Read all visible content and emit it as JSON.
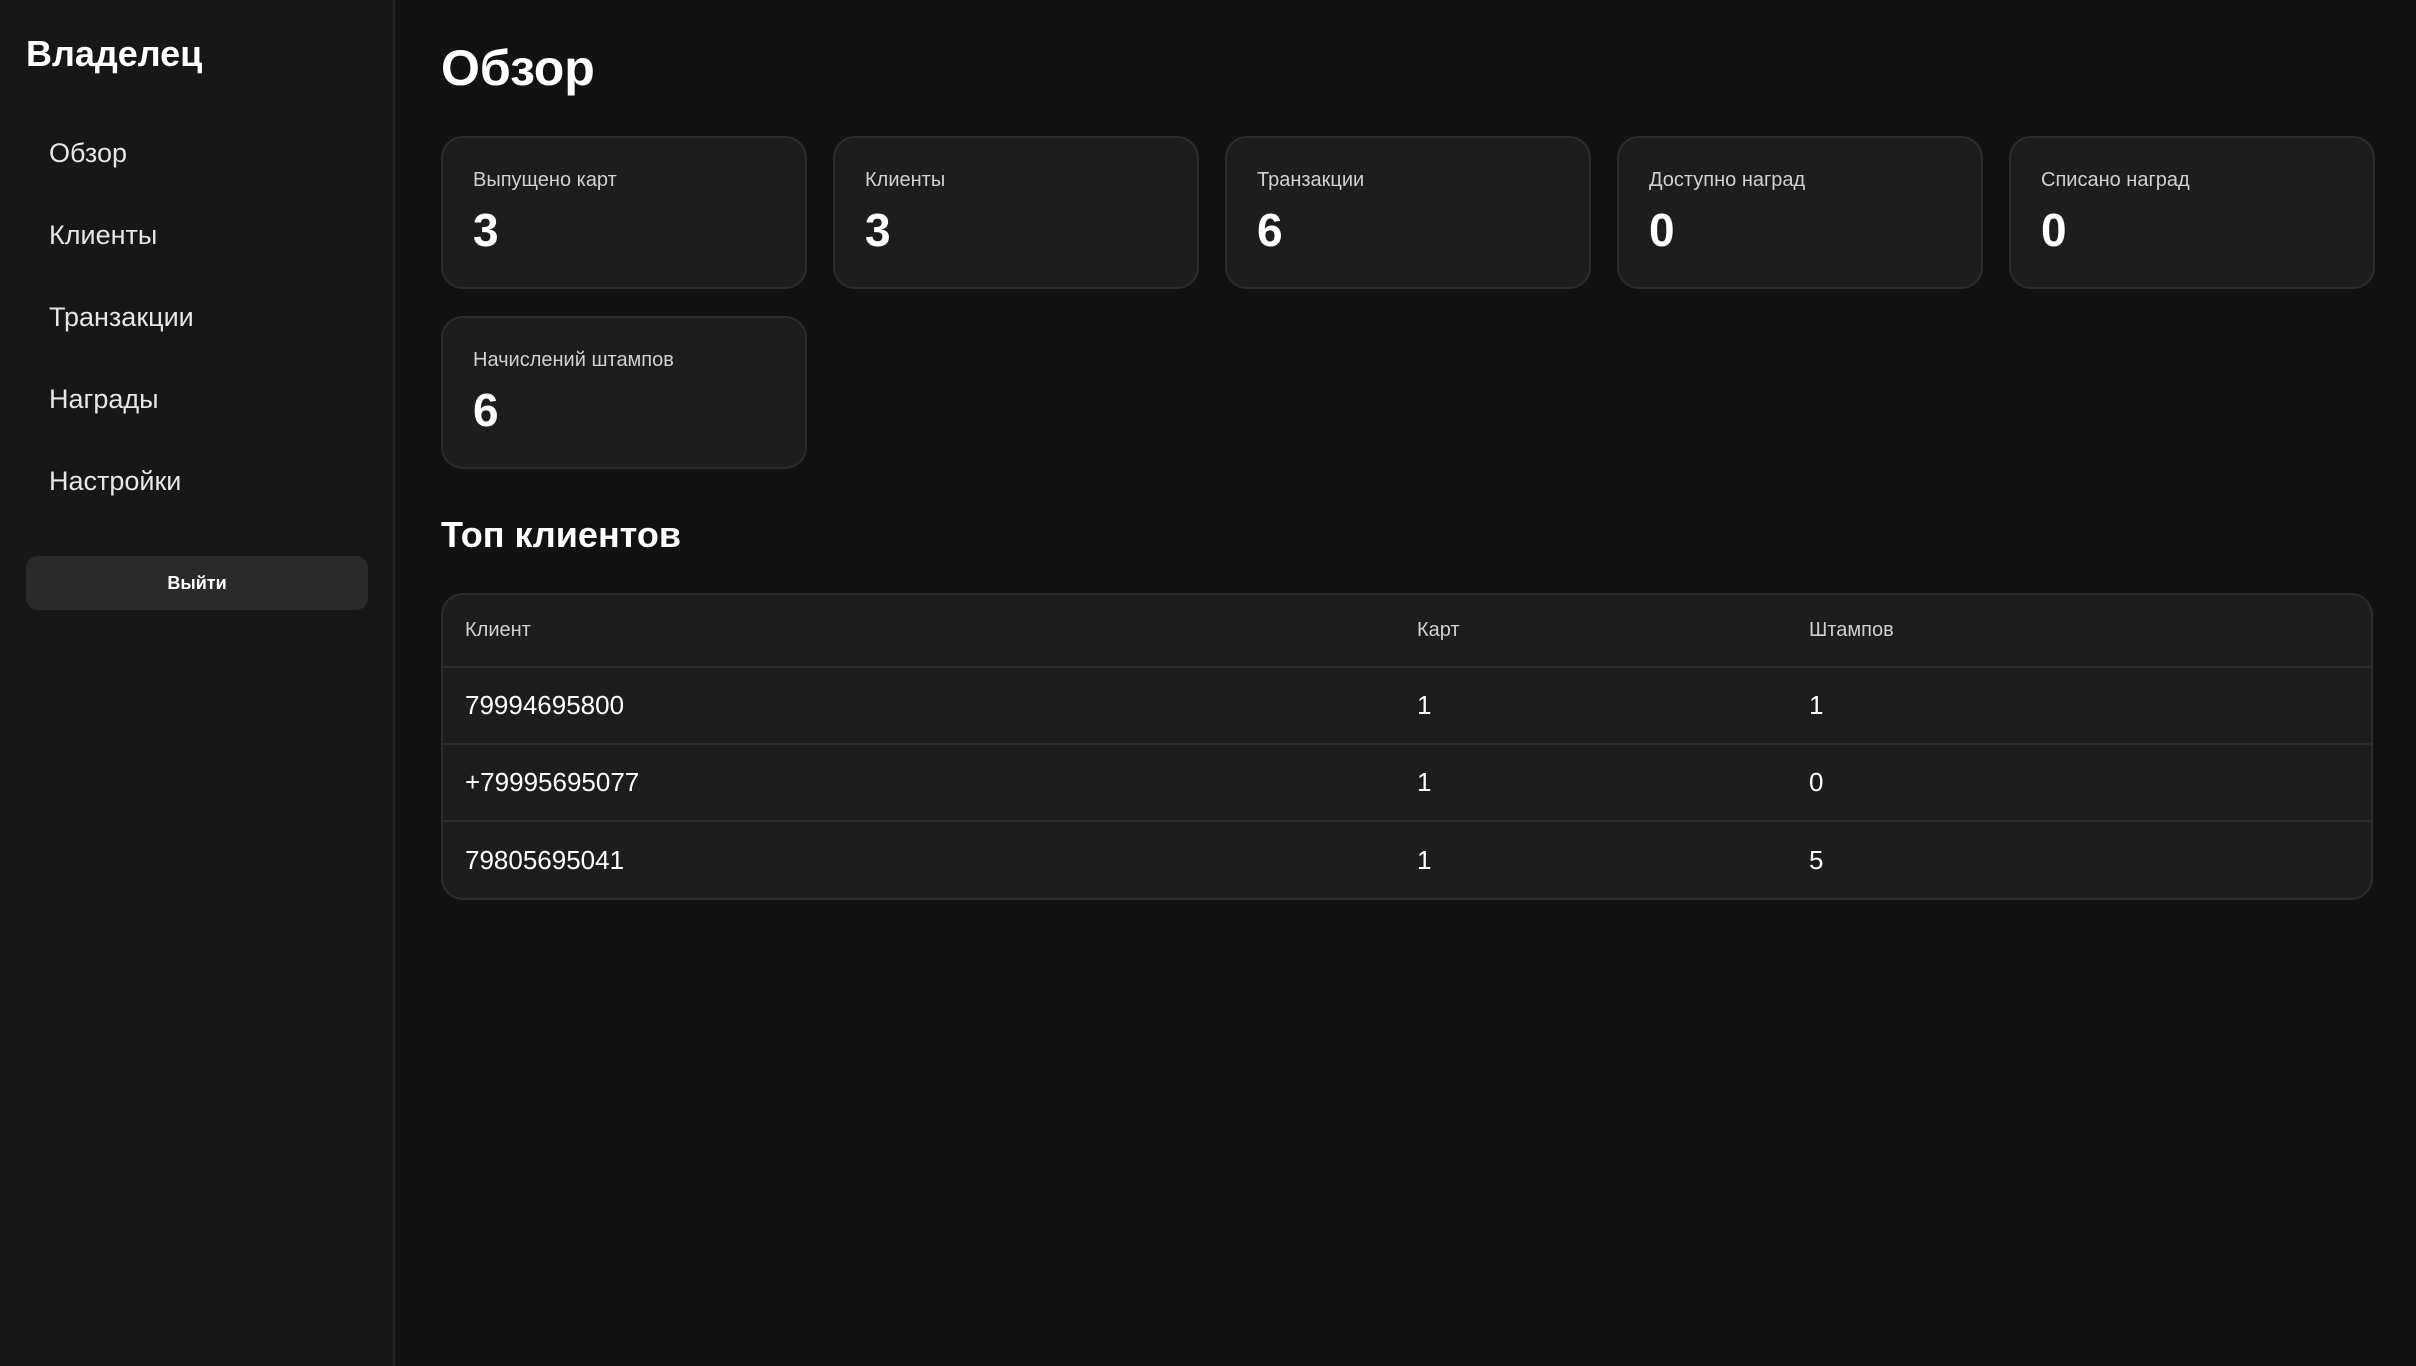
{
  "sidebar": {
    "title": "Владелец",
    "items": [
      {
        "label": "Обзор"
      },
      {
        "label": "Клиенты"
      },
      {
        "label": "Транзакции"
      },
      {
        "label": "Награды"
      },
      {
        "label": "Настройки"
      }
    ],
    "logout_label": "Выйти"
  },
  "main": {
    "title": "Обзор",
    "stats": [
      {
        "label": "Выпущено карт",
        "value": "3"
      },
      {
        "label": "Клиенты",
        "value": "3"
      },
      {
        "label": "Транзакции",
        "value": "6"
      },
      {
        "label": "Доступно наград",
        "value": "0"
      },
      {
        "label": "Списано наград",
        "value": "0"
      },
      {
        "label": "Начислений штампов",
        "value": "6"
      }
    ],
    "top_clients": {
      "title": "Топ клиентов",
      "headers": [
        "Клиент",
        "Карт",
        "Штампов"
      ],
      "rows": [
        [
          "79994695800",
          "1",
          "1"
        ],
        [
          "+79995695077",
          "1",
          "0"
        ],
        [
          "79805695041",
          "1",
          "5"
        ]
      ]
    }
  },
  "colors": {
    "background": "#121212",
    "sidebar": "#171717",
    "card": "#1d1d1d",
    "border": "#2c2c2c",
    "button": "#2a2a2a"
  }
}
